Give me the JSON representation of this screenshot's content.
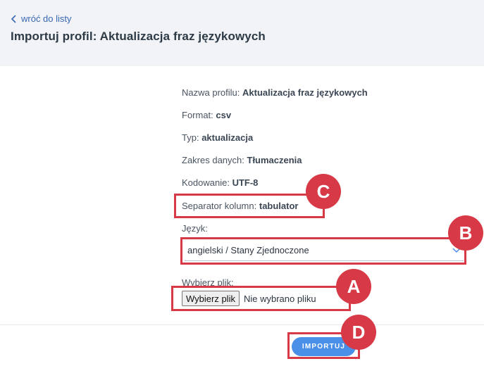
{
  "header": {
    "back_link": "wróć do listy",
    "title": "Importuj profil: Aktualizacja fraz językowych"
  },
  "profile": {
    "name_label": "Nazwa profilu:",
    "name_value": "Aktualizacja fraz językowych",
    "format_label": "Format:",
    "format_value": "csv",
    "type_label": "Typ:",
    "type_value": "aktualizacja",
    "scope_label": "Zakres danych:",
    "scope_value": "Tłumaczenia",
    "encoding_label": "Kodowanie:",
    "encoding_value": "UTF-8",
    "separator_label": "Separator kolumn:",
    "separator_value": "tabulator"
  },
  "language": {
    "label": "Język:",
    "selected": "angielski / Stany Zjednoczone"
  },
  "file": {
    "label": "Wybierz plik:",
    "button": "Wybierz plik",
    "status": "Nie wybrano pliku"
  },
  "actions": {
    "import_label": "IMPORTUJ"
  },
  "markers": {
    "a": "A",
    "b": "B",
    "c": "C",
    "d": "D"
  },
  "colors": {
    "accent": "#4a8fe7",
    "marker": "#d73a46",
    "header_bg": "#f1f3f6",
    "link": "#3867b3"
  }
}
